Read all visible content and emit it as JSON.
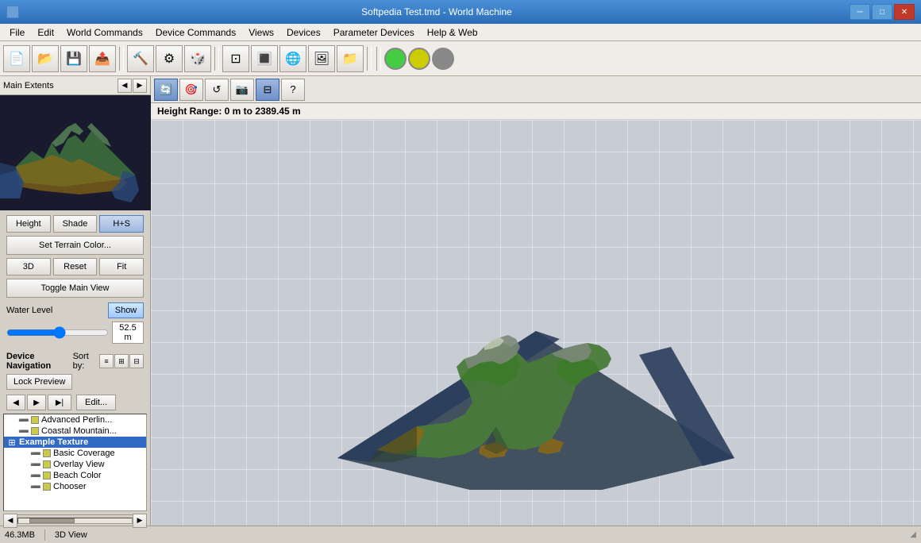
{
  "titleBar": {
    "title": "Softpedia Test.tmd - World Machine",
    "iconLabel": "app-icon"
  },
  "menuBar": {
    "items": [
      "File",
      "Edit",
      "World Commands",
      "Device Commands",
      "Views",
      "Devices",
      "Parameter Devices",
      "Help & Web"
    ]
  },
  "toolbar": {
    "buttons": [
      {
        "name": "new",
        "icon": "📄"
      },
      {
        "name": "open",
        "icon": "📂"
      },
      {
        "name": "save",
        "icon": "💾"
      },
      {
        "name": "export",
        "icon": "📤"
      },
      {
        "name": "build",
        "icon": "🔨"
      },
      {
        "name": "build2",
        "icon": "⚙"
      },
      {
        "name": "random",
        "icon": "🎲"
      },
      {
        "name": "zoom-extents",
        "icon": "⊡"
      },
      {
        "name": "zoom-fit",
        "icon": "🔳"
      },
      {
        "name": "render",
        "icon": "🌐"
      },
      {
        "name": "texture",
        "icon": "🖼"
      },
      {
        "name": "export2",
        "icon": "📁"
      }
    ],
    "indicators": [
      {
        "name": "green-indicator",
        "color": "#44cc44"
      },
      {
        "name": "yellow-indicator",
        "color": "#cccc00"
      },
      {
        "name": "gray-indicator",
        "color": "#888888"
      }
    ]
  },
  "leftPanel": {
    "previewHeader": {
      "label": "Main Extents",
      "navLeft": "◀",
      "navRight": "▶"
    },
    "viewButtons": {
      "height": "Height",
      "shade": "Shade",
      "hs": "H+S",
      "setTerrain": "Set Terrain Color...",
      "btn3d": "3D",
      "reset": "Reset",
      "fit": "Fit",
      "toggleMain": "Toggle Main View"
    },
    "waterLevel": {
      "label": "Water Level",
      "showBtn": "Show",
      "value": "52.5 m",
      "sliderMin": 0,
      "sliderMax": 100,
      "sliderVal": 52.5
    },
    "deviceNavigation": {
      "label": "Device Navigation",
      "sortLabel": "Sort by:"
    },
    "lockPreview": "Lock Preview",
    "navButtons": {
      "prev": "◀",
      "next": "▶",
      "end": "▶|",
      "edit": "Edit..."
    },
    "treeItems": [
      {
        "id": "advanced",
        "label": "Advanced Perlin...",
        "indent": 1,
        "icon": "➖",
        "color": "#cccc44",
        "hasColor": true
      },
      {
        "id": "coastal",
        "label": "Coastal Mountain...",
        "indent": 1,
        "icon": "➖",
        "color": "#cccc44",
        "hasColor": true
      },
      {
        "id": "example-texture",
        "label": "Example Texture",
        "indent": 0,
        "icon": "⊞",
        "color": null,
        "hasColor": false,
        "bold": true,
        "selected": true
      },
      {
        "id": "basic-coverage",
        "label": "Basic Coverage",
        "indent": 2,
        "icon": "➖",
        "color": "#cccc44",
        "hasColor": true
      },
      {
        "id": "overlay-view",
        "label": "Overlay View",
        "indent": 2,
        "icon": "➖",
        "color": "#cccc44",
        "hasColor": true
      },
      {
        "id": "beach-color",
        "label": "Beach Color",
        "indent": 2,
        "icon": "➖",
        "color": "#cccc44",
        "hasColor": true
      },
      {
        "id": "chooser",
        "label": "Chooser",
        "indent": 2,
        "icon": "➖",
        "color": "#cccc44",
        "hasColor": true
      }
    ]
  },
  "viewToolbar": {
    "buttons": [
      {
        "name": "orbit",
        "label": "Orbit",
        "icon": "🔄",
        "active": true
      },
      {
        "name": "free",
        "label": "Free",
        "icon": "🎯",
        "active": false
      },
      {
        "name": "reset-view",
        "label": "Reset",
        "icon": "↺",
        "active": false
      },
      {
        "name": "screenshot",
        "label": "Screenshot",
        "icon": "📷",
        "active": false
      },
      {
        "name": "wireframe",
        "label": "Wireframe",
        "icon": "⊟",
        "active": true
      },
      {
        "name": "help",
        "label": "Help",
        "icon": "?",
        "active": false
      }
    ]
  },
  "heightInfo": "Height Range: 0 m to 2389.45 m",
  "statusBar": {
    "memory": "46.3MB",
    "view": "3D View"
  }
}
